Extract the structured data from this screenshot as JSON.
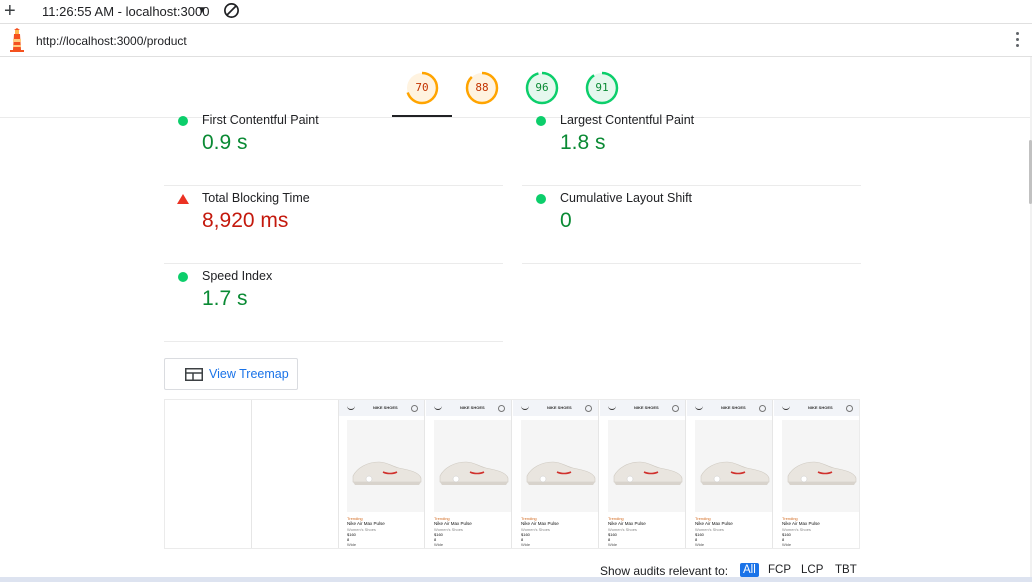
{
  "topbar": {
    "time_label": "11:26:55 AM - localhost:3000",
    "plus_icon": "plus-icon",
    "caret_icon": "caret-down-icon",
    "block_icon": "block-icon"
  },
  "urlbar": {
    "url": "http://localhost:3000/product"
  },
  "scores": [
    {
      "value": "70",
      "color": "#ffa400",
      "fill": "#fff3e0",
      "text_color": "#c33300",
      "fraction": 0.7
    },
    {
      "value": "88",
      "color": "#ffa400",
      "fill": "#fff3e0",
      "text_color": "#c33300",
      "fraction": 0.88
    },
    {
      "value": "96",
      "color": "#0cce6b",
      "fill": "#e6f8ee",
      "text_color": "#0a8a34",
      "fraction": 0.96
    },
    {
      "value": "91",
      "color": "#0cce6b",
      "fill": "#e6f8ee",
      "text_color": "#0a8a34",
      "fraction": 0.91
    }
  ],
  "metrics": [
    {
      "label": "First Contentful Paint",
      "value": "0.9 s",
      "status": "good"
    },
    {
      "label": "Largest Contentful Paint",
      "value": "1.8 s",
      "status": "good"
    },
    {
      "label": "Total Blocking Time",
      "value": "8,920 ms",
      "status": "bad"
    },
    {
      "label": "Cumulative Layout Shift",
      "value": "0",
      "status": "good"
    },
    {
      "label": "Speed Index",
      "value": "1.7 s",
      "status": "good"
    }
  ],
  "treemap": {
    "label": "View Treemap"
  },
  "filmstrip": {
    "thumb": {
      "brand": "NIKE SHOES",
      "trending": "Trending",
      "name": "Nike Air Max Pulse",
      "category": "Women's Shoes",
      "price": "$160",
      "count": "8",
      "width": "Wide"
    }
  },
  "audits_filter": {
    "label": "Show audits relevant to:",
    "options": [
      "All",
      "FCP",
      "LCP",
      "TBT"
    ],
    "active": "All"
  }
}
